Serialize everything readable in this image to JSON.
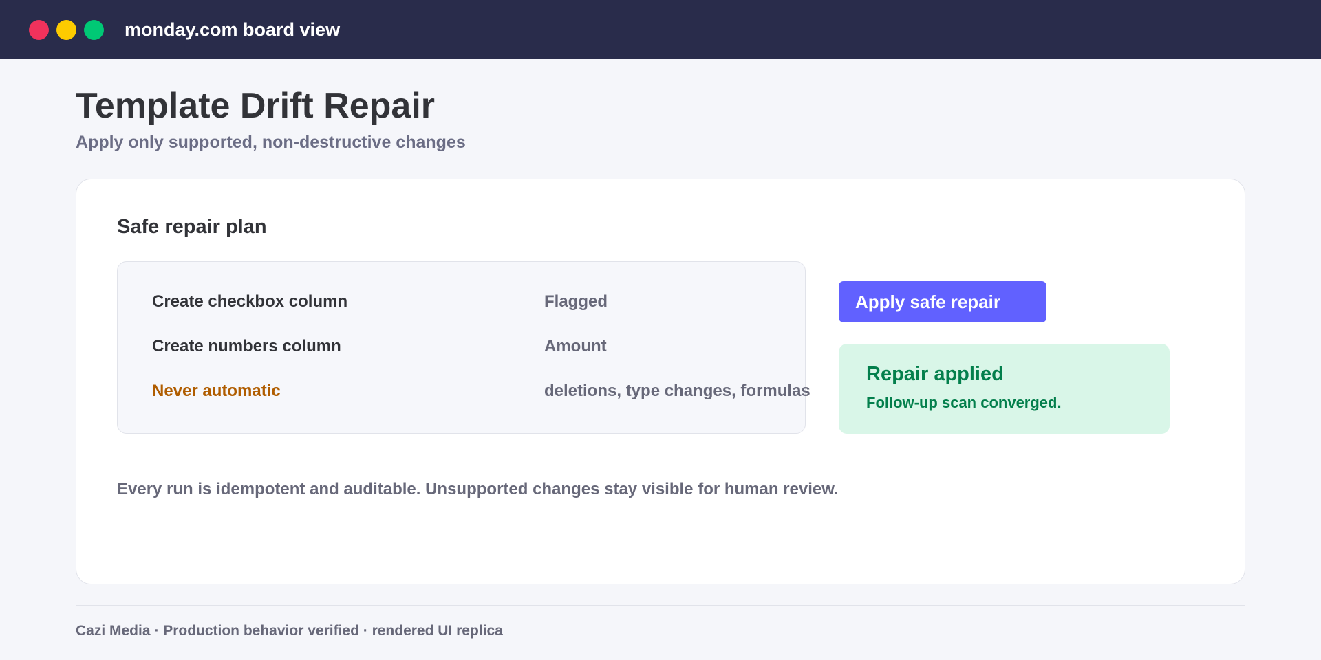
{
  "window": {
    "title": "monday.com board view"
  },
  "page": {
    "title": "Template Drift Repair",
    "subtitle": "Apply only supported, non-destructive changes"
  },
  "card": {
    "title": "Safe repair plan",
    "plan_rows": [
      {
        "label": "Create checkbox column",
        "value": "Flagged"
      },
      {
        "label": "Create numbers column",
        "value": "Amount"
      },
      {
        "label": "Never automatic",
        "value": "deletions, type changes, formulas"
      }
    ],
    "apply_button_label": "Apply safe repair",
    "status": {
      "title": "Repair applied",
      "message": "Follow-up scan converged."
    },
    "note": "Every run is idempotent and auditable. Unsupported changes stay visible for human review."
  },
  "footer": {
    "text": "Cazi Media · Production behavior verified · rendered UI replica"
  },
  "colors": {
    "titlebar": "#292c4b",
    "primary_button": "#6161ff",
    "success_bg": "#d9f6e8",
    "success_text": "#037f4c",
    "warning_text": "#b05d00"
  }
}
